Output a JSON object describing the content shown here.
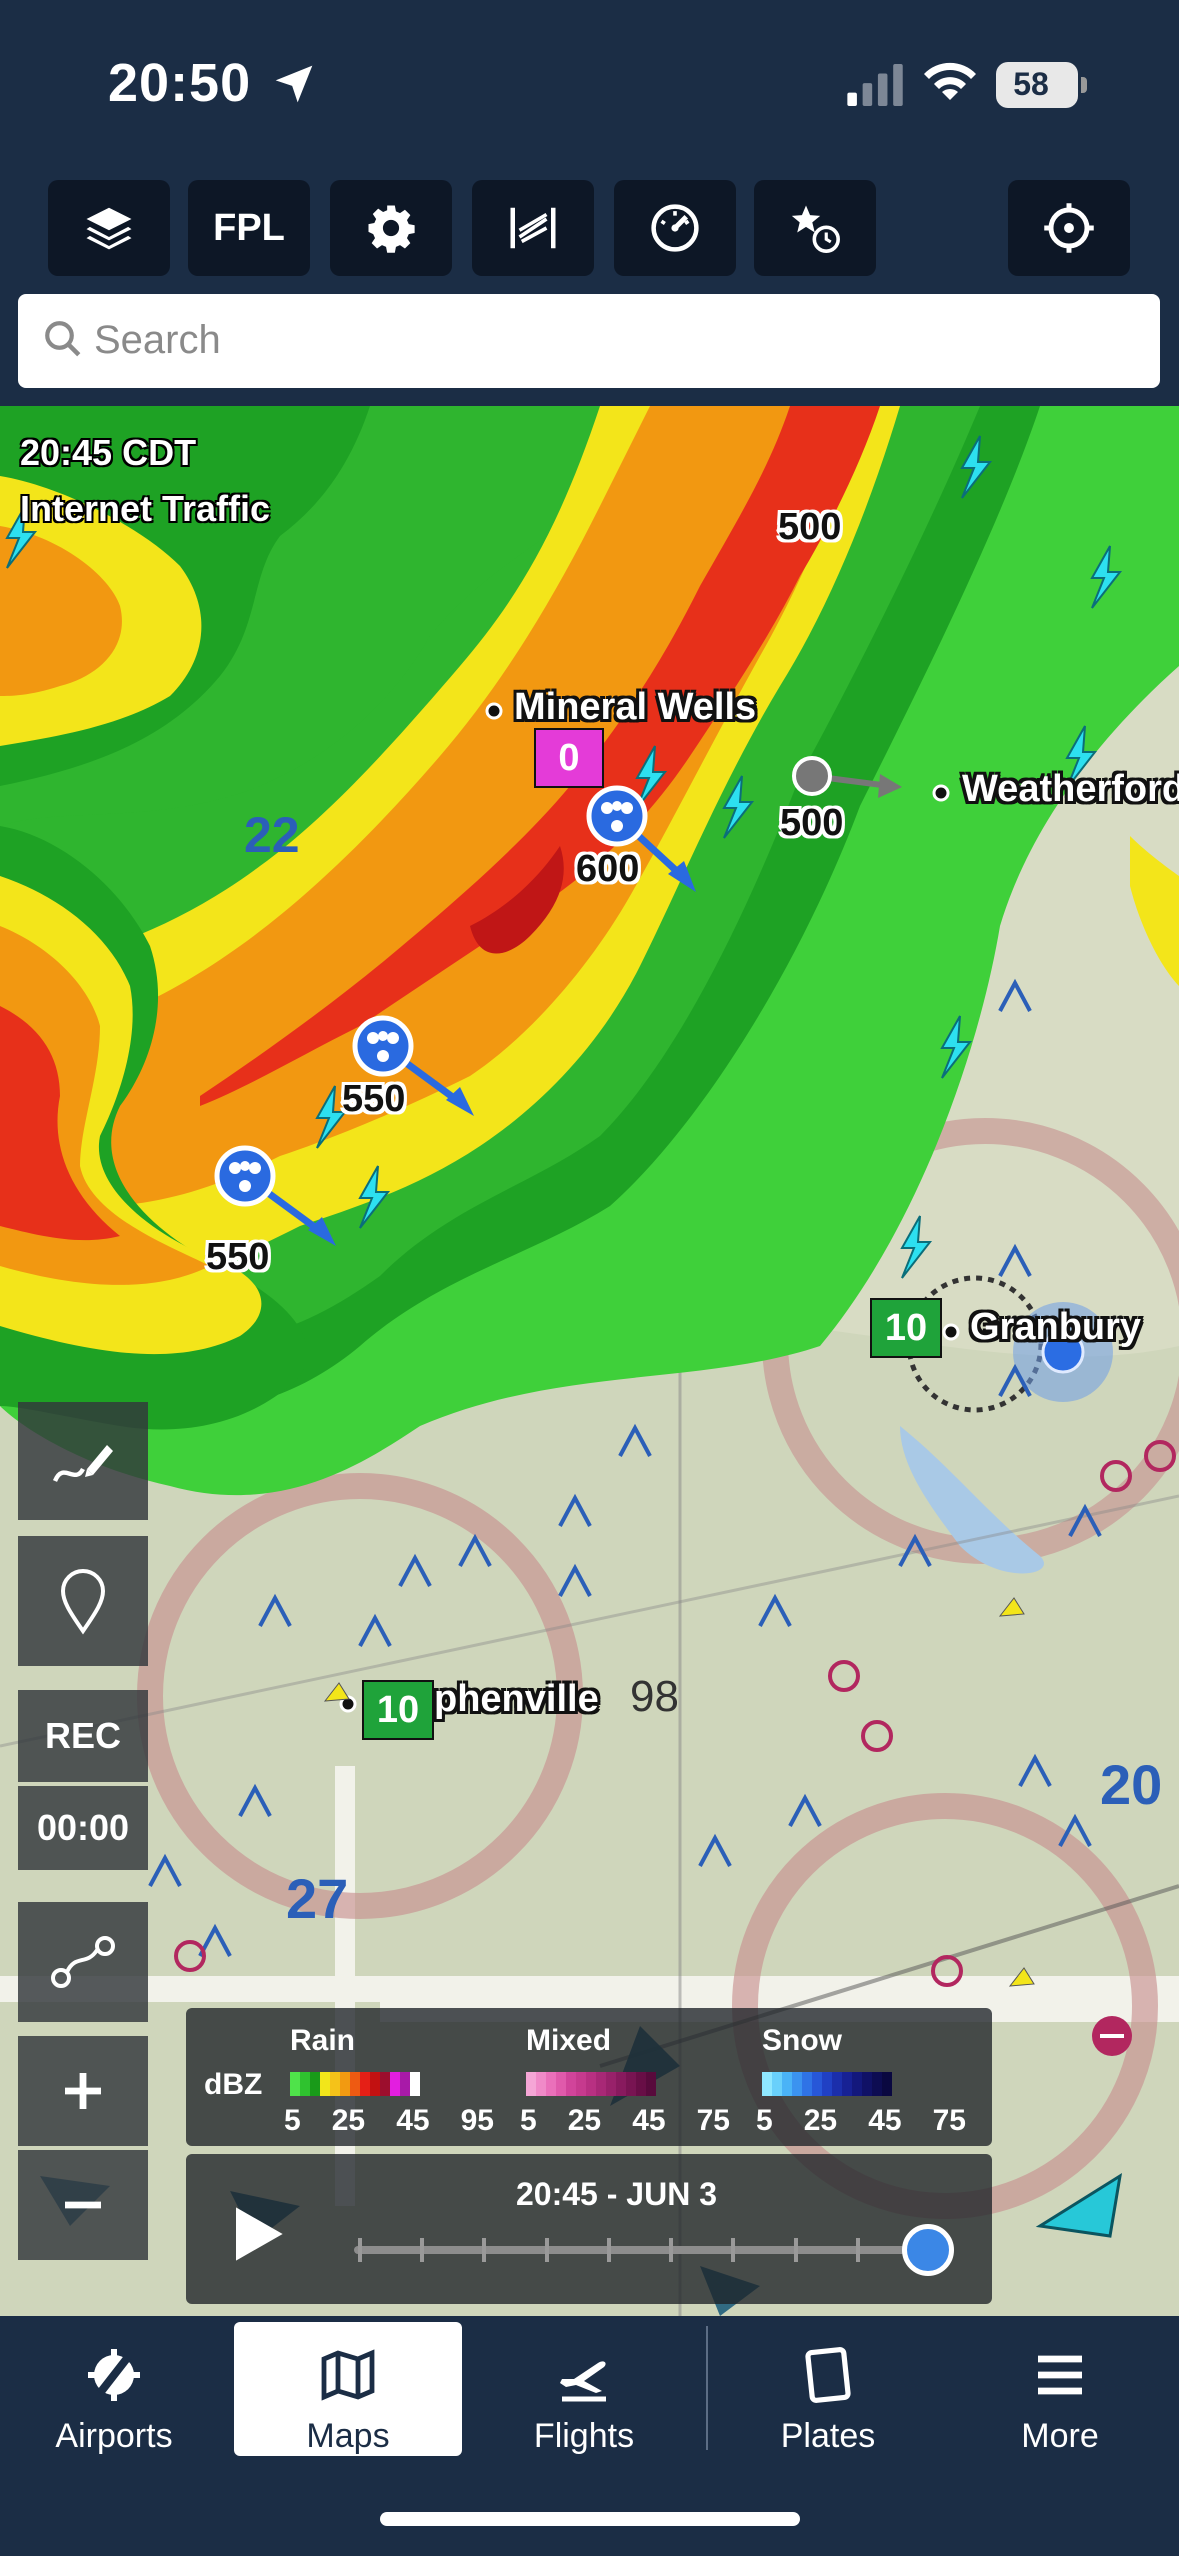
{
  "status_bar": {
    "time": "20:50",
    "battery": "58"
  },
  "toolbar": {
    "buttons": [
      {
        "name": "layers-button",
        "label": "",
        "icon": "layers-icon"
      },
      {
        "name": "fpl-button",
        "label": "FPL",
        "icon": ""
      },
      {
        "name": "settings-button",
        "label": "",
        "icon": "gear-icon"
      },
      {
        "name": "profile-button",
        "label": "",
        "icon": "profile-view-icon"
      },
      {
        "name": "instruments-button",
        "label": "",
        "icon": "gauge-icon"
      },
      {
        "name": "favorites-history-button",
        "label": "",
        "icon": "star-clock-icon"
      },
      {
        "name": "center-location-button",
        "label": "",
        "icon": "crosshair-icon"
      }
    ]
  },
  "search": {
    "placeholder": "Search"
  },
  "map": {
    "time_label": "20:45 CDT",
    "source_label": "Internet Traffic",
    "cities": {
      "mineral_wells": "Mineral Wells",
      "weatherford": "Weatherford",
      "granbury": "Granbury",
      "stephenville": "phenville"
    },
    "traffic": [
      {
        "altitude": "500",
        "color": "#777777"
      },
      {
        "altitude": "600",
        "color": "#2a6ae0"
      },
      {
        "altitude": "550",
        "color": "#2a6ae0"
      },
      {
        "altitude": "550",
        "color": "#2a6ae0"
      },
      {
        "altitude": "500",
        "color": "#222222"
      }
    ],
    "boxes": [
      {
        "value": "0",
        "color": "#e43bd8"
      },
      {
        "value": "10",
        "color": "#1fa33a"
      },
      {
        "value": "10",
        "color": "#1fa33a"
      }
    ],
    "chart_labels": {
      "airspace_22": "22",
      "airspace_27": "27",
      "airspace_20": "20",
      "alt_98": "98",
      "alt_98b": "98"
    }
  },
  "side_controls": {
    "rec_label": "REC",
    "rec_timer": "00:00"
  },
  "legend": {
    "unit": "dBZ",
    "groups": [
      {
        "title": "Rain",
        "ticks": [
          "5",
          "25",
          "45",
          "95"
        ],
        "colors": [
          "#4fe34a",
          "#2fc22f",
          "#199a19",
          "#f2e61a",
          "#f5c219",
          "#f29a11",
          "#ee5a12",
          "#e51f16",
          "#c21111",
          "#9c0e2d",
          "#e31ee0",
          "#a81aa8",
          "#ffffff"
        ]
      },
      {
        "title": "Mixed",
        "ticks": [
          "5",
          "25",
          "45",
          "75"
        ],
        "colors": [
          "#f5a6d6",
          "#f08ac8",
          "#ea70ba",
          "#e05aab",
          "#d1449a",
          "#c63a8e",
          "#b83082",
          "#a82876",
          "#98216a",
          "#881a5e",
          "#781452",
          "#680e46",
          "#580a3c"
        ]
      },
      {
        "title": "Snow",
        "ticks": [
          "5",
          "25",
          "45",
          "75"
        ],
        "colors": [
          "#8fe7ff",
          "#69d0fb",
          "#4ab3f7",
          "#3b93f0",
          "#2f73e6",
          "#2757d8",
          "#2040c4",
          "#1b2eab",
          "#172194",
          "#13187c",
          "#101166",
          "#0d0c52",
          "#0a0840"
        ]
      }
    ]
  },
  "timeline": {
    "label": "20:45 - JUN 3",
    "position": 1.0
  },
  "tabs": [
    {
      "label": "Airports",
      "icon": "airport-icon",
      "active": false
    },
    {
      "label": "Maps",
      "icon": "map-icon",
      "active": true
    },
    {
      "label": "Flights",
      "icon": "airplane-icon",
      "active": false
    },
    {
      "label": "Plates",
      "icon": "plate-icon",
      "active": false
    },
    {
      "label": "More",
      "icon": "menu-icon",
      "active": false
    }
  ]
}
